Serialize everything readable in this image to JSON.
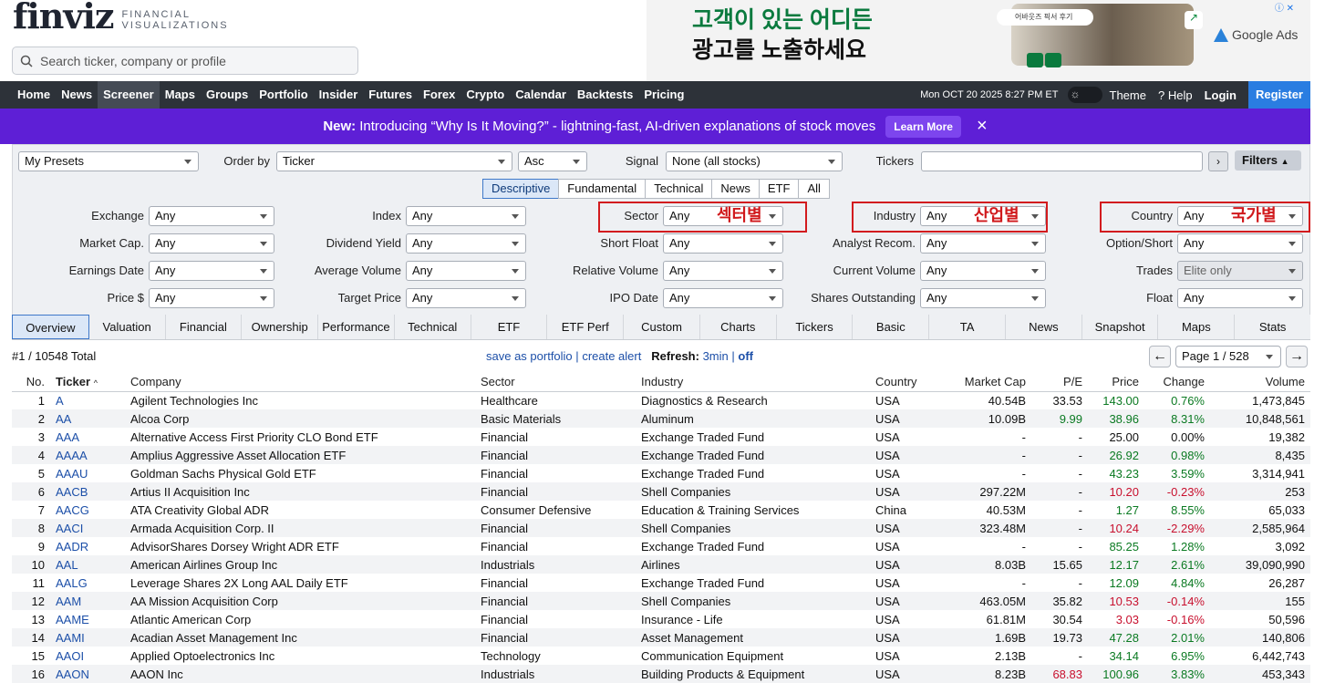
{
  "logo": {
    "word": "finviz",
    "sub1": "FINANCIAL",
    "sub2": "VISUALIZATIONS"
  },
  "search": {
    "placeholder": "Search ticker, company or profile"
  },
  "ad": {
    "line1": "고객이 있는 어디든",
    "line2": "광고를 노출하세요",
    "pill": "어바웃즈 픽서 후기",
    "brand": "Google Ads"
  },
  "nav": {
    "items": [
      "Home",
      "News",
      "Screener",
      "Maps",
      "Groups",
      "Portfolio",
      "Insider",
      "Futures",
      "Forex",
      "Crypto",
      "Calendar",
      "Backtests",
      "Pricing"
    ],
    "datetime": "Mon OCT 20 2025 8:27 PM ET",
    "theme": "Theme",
    "help": "Help",
    "login": "Login",
    "register": "Register"
  },
  "banner": {
    "bold": "New:",
    "text": "Introducing “Why Is It Moving?” - lightning-fast, AI-driven explanations of stock moves",
    "button": "Learn More",
    "close": "×"
  },
  "controls": {
    "presets": "My Presets",
    "order_label": "Order by",
    "order_value": "Ticker",
    "dir": "Asc",
    "signal_label": "Signal",
    "signal_value": "None (all stocks)",
    "tickers_label": "Tickers",
    "filters_label": "Filters"
  },
  "filter_tabs": [
    "Descriptive",
    "Fundamental",
    "Technical",
    "News",
    "ETF",
    "All"
  ],
  "filters": [
    [
      "Exchange",
      "Any"
    ],
    [
      "Index",
      "Any"
    ],
    [
      "Sector",
      "Any"
    ],
    [
      "Industry",
      "Any"
    ],
    [
      "Country",
      "Any"
    ],
    [
      "Market Cap.",
      "Any"
    ],
    [
      "Dividend Yield",
      "Any"
    ],
    [
      "Short Float",
      "Any"
    ],
    [
      "Analyst Recom.",
      "Any"
    ],
    [
      "Option/Short",
      "Any"
    ],
    [
      "Earnings Date",
      "Any"
    ],
    [
      "Average Volume",
      "Any"
    ],
    [
      "Relative Volume",
      "Any"
    ],
    [
      "Current Volume",
      "Any"
    ],
    [
      "Trades",
      "Elite only"
    ],
    [
      "Price $",
      "Any"
    ],
    [
      "Target Price",
      "Any"
    ],
    [
      "IPO Date",
      "Any"
    ],
    [
      "Shares Outstanding",
      "Any"
    ],
    [
      "Float",
      "Any"
    ]
  ],
  "annotations": {
    "sector": "섹터별",
    "industry": "산업별",
    "country": "국가별"
  },
  "view_tabs": [
    "Overview",
    "Valuation",
    "Financial",
    "Ownership",
    "Performance",
    "Technical",
    "ETF",
    "ETF Perf",
    "Custom",
    "Charts",
    "Tickers",
    "Basic",
    "TA",
    "News",
    "Snapshot",
    "Maps",
    "Stats"
  ],
  "status": {
    "total": "#1 / 10548 Total",
    "save": "save as portfolio",
    "sep": "|",
    "alert": "create alert",
    "refresh_label": "Refresh:",
    "refresh_val": "3min",
    "sep2": "|",
    "off": "off",
    "page": "Page 1 / 528"
  },
  "table": {
    "headers": [
      "No.",
      "Ticker",
      "Company",
      "Sector",
      "Industry",
      "Country",
      "Market Cap",
      "P/E",
      "Price",
      "Change",
      "Volume"
    ],
    "rows": [
      [
        "1",
        "A",
        "Agilent Technologies Inc",
        "Healthcare",
        "Diagnostics & Research",
        "USA",
        "40.54B",
        "33.53",
        "143.00",
        "0.76%",
        "1,473,845"
      ],
      [
        "2",
        "AA",
        "Alcoa Corp",
        "Basic Materials",
        "Aluminum",
        "USA",
        "10.09B",
        "9.99",
        "38.96",
        "8.31%",
        "10,848,561"
      ],
      [
        "3",
        "AAA",
        "Alternative Access First Priority CLO Bond ETF",
        "Financial",
        "Exchange Traded Fund",
        "USA",
        "-",
        "-",
        "25.00",
        "0.00%",
        "19,382"
      ],
      [
        "4",
        "AAAA",
        "Amplius Aggressive Asset Allocation ETF",
        "Financial",
        "Exchange Traded Fund",
        "USA",
        "-",
        "-",
        "26.92",
        "0.98%",
        "8,435"
      ],
      [
        "5",
        "AAAU",
        "Goldman Sachs Physical Gold ETF",
        "Financial",
        "Exchange Traded Fund",
        "USA",
        "-",
        "-",
        "43.23",
        "3.59%",
        "3,314,941"
      ],
      [
        "6",
        "AACB",
        "Artius II Acquisition Inc",
        "Financial",
        "Shell Companies",
        "USA",
        "297.22M",
        "-",
        "10.20",
        "-0.23%",
        "253"
      ],
      [
        "7",
        "AACG",
        "ATA Creativity Global ADR",
        "Consumer Defensive",
        "Education & Training Services",
        "China",
        "40.53M",
        "-",
        "1.27",
        "8.55%",
        "65,033"
      ],
      [
        "8",
        "AACI",
        "Armada Acquisition Corp. II",
        "Financial",
        "Shell Companies",
        "USA",
        "323.48M",
        "-",
        "10.24",
        "-2.29%",
        "2,585,964"
      ],
      [
        "9",
        "AADR",
        "AdvisorShares Dorsey Wright ADR ETF",
        "Financial",
        "Exchange Traded Fund",
        "USA",
        "-",
        "-",
        "85.25",
        "1.28%",
        "3,092"
      ],
      [
        "10",
        "AAL",
        "American Airlines Group Inc",
        "Industrials",
        "Airlines",
        "USA",
        "8.03B",
        "15.65",
        "12.17",
        "2.61%",
        "39,090,990"
      ],
      [
        "11",
        "AALG",
        "Leverage Shares 2X Long AAL Daily ETF",
        "Financial",
        "Exchange Traded Fund",
        "USA",
        "-",
        "-",
        "12.09",
        "4.84%",
        "26,287"
      ],
      [
        "12",
        "AAM",
        "AA Mission Acquisition Corp",
        "Financial",
        "Shell Companies",
        "USA",
        "463.05M",
        "35.82",
        "10.53",
        "-0.14%",
        "155"
      ],
      [
        "13",
        "AAME",
        "Atlantic American Corp",
        "Financial",
        "Insurance - Life",
        "USA",
        "61.81M",
        "30.54",
        "3.03",
        "-0.16%",
        "50,596"
      ],
      [
        "14",
        "AAMI",
        "Acadian Asset Management Inc",
        "Financial",
        "Asset Management",
        "USA",
        "1.69B",
        "19.73",
        "47.28",
        "2.01%",
        "140,806"
      ],
      [
        "15",
        "AAOI",
        "Applied Optoelectronics Inc",
        "Technology",
        "Communication Equipment",
        "USA",
        "2.13B",
        "-",
        "34.14",
        "6.95%",
        "6,442,743"
      ],
      [
        "16",
        "AAON",
        "AAON Inc",
        "Industrials",
        "Building Products & Equipment",
        "USA",
        "8.23B",
        "68.83",
        "100.96",
        "3.83%",
        "453,343"
      ]
    ],
    "pe_colors": {
      "2": "pos",
      "16": "neg"
    }
  }
}
